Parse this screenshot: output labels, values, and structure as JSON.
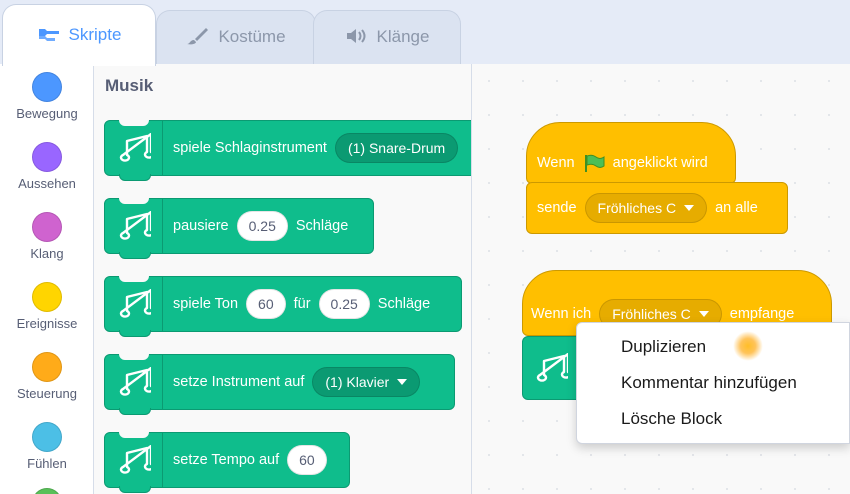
{
  "tabs": [
    {
      "label": "Skripte",
      "icon": "code-icon",
      "active": true
    },
    {
      "label": "Kostüme",
      "icon": "brush-icon",
      "active": false
    },
    {
      "label": "Klänge",
      "icon": "speaker-icon",
      "active": false
    }
  ],
  "categories": [
    {
      "label": "Bewegung",
      "color": "#4c97ff"
    },
    {
      "label": "Aussehen",
      "color": "#9966ff"
    },
    {
      "label": "Klang",
      "color": "#cf63cf"
    },
    {
      "label": "Ereignisse",
      "color": "#ffd500"
    },
    {
      "label": "Steuerung",
      "color": "#ffab19"
    },
    {
      "label": "Fühlen",
      "color": "#4cbfe6"
    },
    {
      "label": "",
      "color": "#59c059"
    }
  ],
  "palette": {
    "title": "Musik",
    "blocks": [
      {
        "text": "spiele Schlaginstrument",
        "dropdown": "(1) Snare-Drum"
      },
      {
        "text": "pausiere",
        "value": "0.25",
        "suffix": "Schläge"
      },
      {
        "text": "spiele Ton",
        "value": "60",
        "middle": "für",
        "value2": "0.25",
        "suffix": "Schläge"
      },
      {
        "text": "setze Instrument auf",
        "dropdown": "(1) Klavier"
      },
      {
        "text": "setze Tempo auf",
        "value": "60"
      }
    ]
  },
  "workspace": {
    "script1": {
      "hat_prefix": "Wenn",
      "hat_suffix": "angeklickt wird",
      "send_prefix": "sende",
      "send_value": "Fröhliches C",
      "send_suffix": "an alle"
    },
    "script2": {
      "hat_prefix": "Wenn ich",
      "hat_value": "Fröhliches C",
      "hat_suffix": "empfange"
    }
  },
  "context_menu": {
    "items": [
      "Duplizieren",
      "Kommentar hinzufügen",
      "Lösche Block"
    ]
  },
  "colors": {
    "accent": "#4c97ff",
    "music": "#0fbd8c",
    "events": "#ffbf00"
  }
}
